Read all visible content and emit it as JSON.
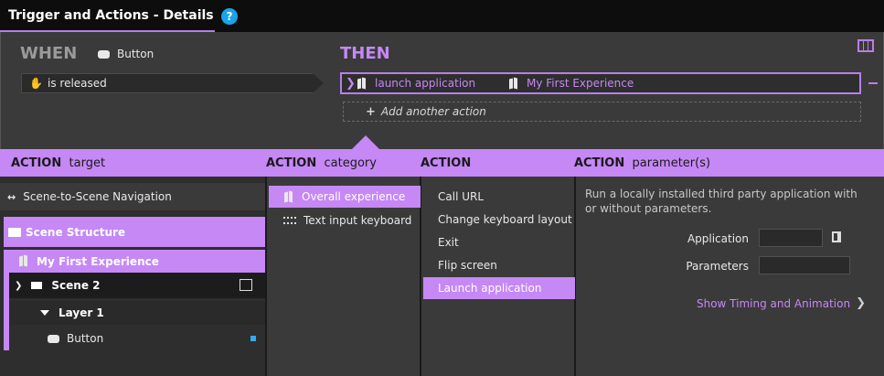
{
  "title": "Trigger and Actions - Details",
  "help_icon": "?",
  "when": {
    "label": "WHEN",
    "device": "Button",
    "event": "is released"
  },
  "then": {
    "label": "THEN",
    "action_name": "launch application",
    "action_target": "My First Experience",
    "add_action": "Add another action"
  },
  "headers": {
    "target_bold": "ACTION",
    "target": "target",
    "category_bold": "ACTION",
    "category": "category",
    "action_bold": "ACTION",
    "param_bold": "ACTION",
    "param": "parameter(s)"
  },
  "targets": {
    "navigation": "Scene-to-Scene Navigation",
    "structure": "Scene Structure",
    "experience": "My First Experience",
    "scene": "Scene 2",
    "layer": "Layer 1",
    "button": "Button"
  },
  "categories": [
    "Overall experience",
    "Text input keyboard"
  ],
  "actions": [
    "Call URL",
    "Change keyboard layout",
    "Exit",
    "Flip screen",
    "Launch application"
  ],
  "params": {
    "description": "Run a locally installed third party application with or without parameters.",
    "application_label": "Application",
    "application_value": "",
    "parameters_label": "Parameters",
    "parameters_value": "",
    "timing_link": "Show Timing and Animation"
  },
  "colors": {
    "accent": "#c588f5",
    "selected_bg": "#c588f5",
    "help_blue": "#1aa3e8",
    "status_dot": "#33aaee"
  },
  "icons": {
    "help": "help-icon",
    "hand": "hand-icon",
    "experience": "experience-icon",
    "keyboard": "keyboard-icon",
    "layers": "layers-icon"
  }
}
